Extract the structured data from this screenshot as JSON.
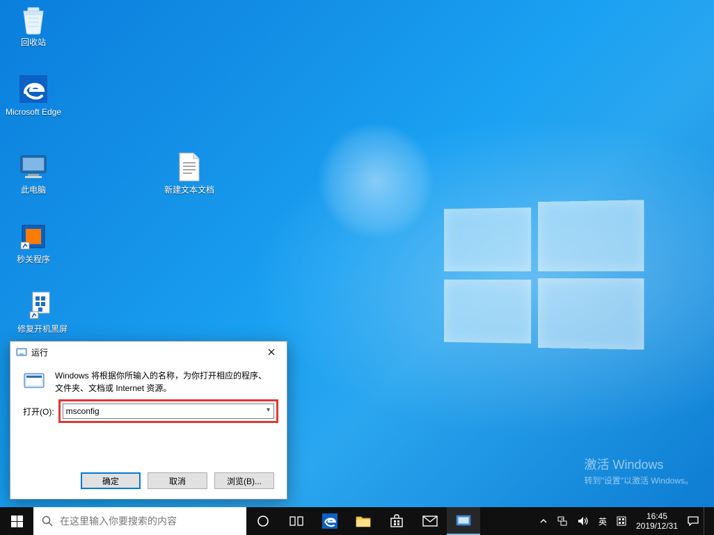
{
  "desktop_icons": {
    "recycle_bin": "回收站",
    "edge": "Microsoft Edge",
    "this_pc": "此电脑",
    "text_doc": "新建文本文档",
    "shutdown_tool": "秒关程序",
    "repair_blackscreen": "修复开机黑屏"
  },
  "activation": {
    "title": "激活 Windows",
    "subtitle": "转到\"设置\"以激活 Windows。"
  },
  "run_dialog": {
    "title": "运行",
    "description": "Windows 将根据你所输入的名称，为你打开相应的程序、文件夹、文档或 Internet 资源。",
    "open_label": "打开(O):",
    "input_value": "msconfig",
    "ok": "确定",
    "cancel": "取消",
    "browse": "浏览(B)..."
  },
  "taskbar": {
    "search_placeholder": "在这里输入你要搜索的内容",
    "ime": "英",
    "time": "16:45",
    "date": "2019/12/31"
  }
}
